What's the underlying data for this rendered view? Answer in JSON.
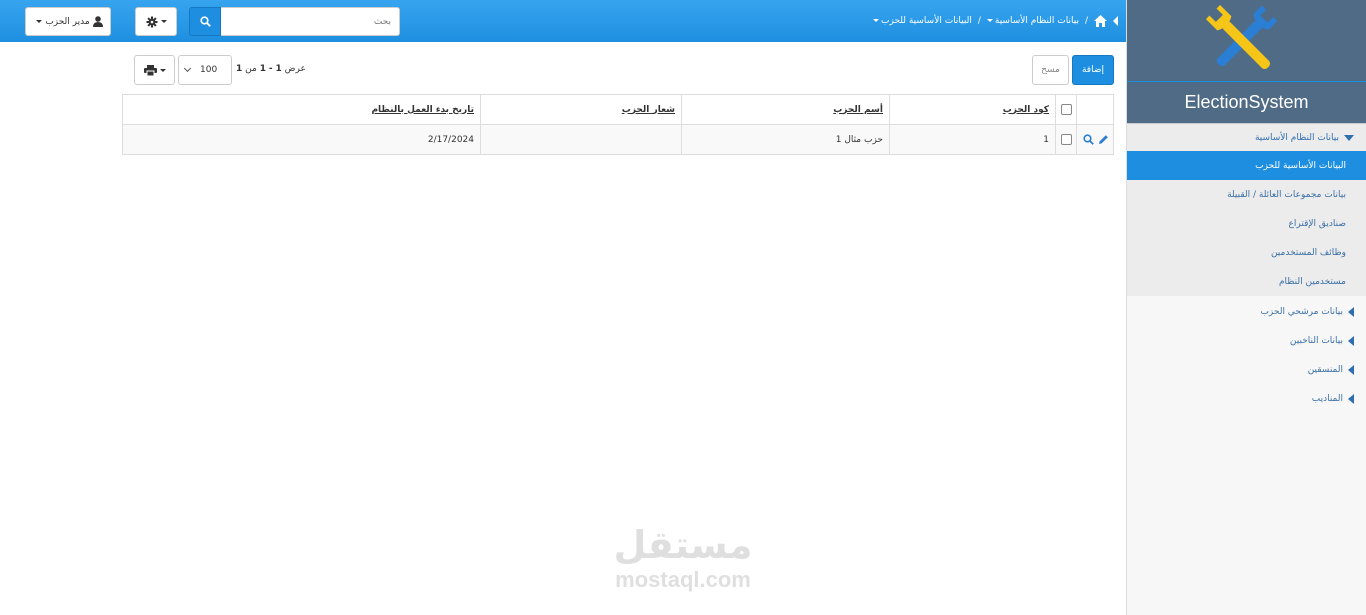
{
  "app": {
    "name": "ElectionSystem"
  },
  "breadcrumb": {
    "items": [
      "بيانات النظام الأساسية",
      "البيانات الأساسية للحزب"
    ],
    "separator": "/"
  },
  "search": {
    "placeholder": "بحث"
  },
  "user_menu": {
    "label": "مدير الحزب"
  },
  "sidebar": {
    "open_group": "بيانات النظام الأساسية",
    "sub_items": [
      "البيانات الأساسية للحزب",
      "بيانات مجموعات العائلة / القبيلة",
      "صناديق الإقتراع",
      "وظائف المستخدمين",
      "مستخدمين النظام"
    ],
    "groups": [
      "بيانات مرشحي الحزب",
      "بيانات الناخبين",
      "المنسقين",
      "المناديب"
    ]
  },
  "toolbar": {
    "add_label": "إضافة",
    "clear_label": "مسح",
    "page_size": "100",
    "paging": {
      "prefix": "عرض",
      "from": "1",
      "dash": "-",
      "to": "1",
      "of_label": "من",
      "total": "1"
    }
  },
  "table": {
    "columns": [
      "كود الحزب",
      "أسم الحزب",
      "شعار الحزب",
      "تاريخ بدء العمل بالنظام"
    ],
    "rows": [
      {
        "code": "1",
        "name": "حزب مثال 1",
        "logo": "",
        "start_date": "2/17/2024"
      }
    ]
  },
  "watermark": {
    "arabic": "مستقل",
    "latin": "mostaql.com"
  },
  "colors": {
    "primary": "#1e8fe0",
    "sidebar_header": "#506b86",
    "logo_yellow": "#f5c518",
    "logo_blue": "#2a7ed3"
  }
}
